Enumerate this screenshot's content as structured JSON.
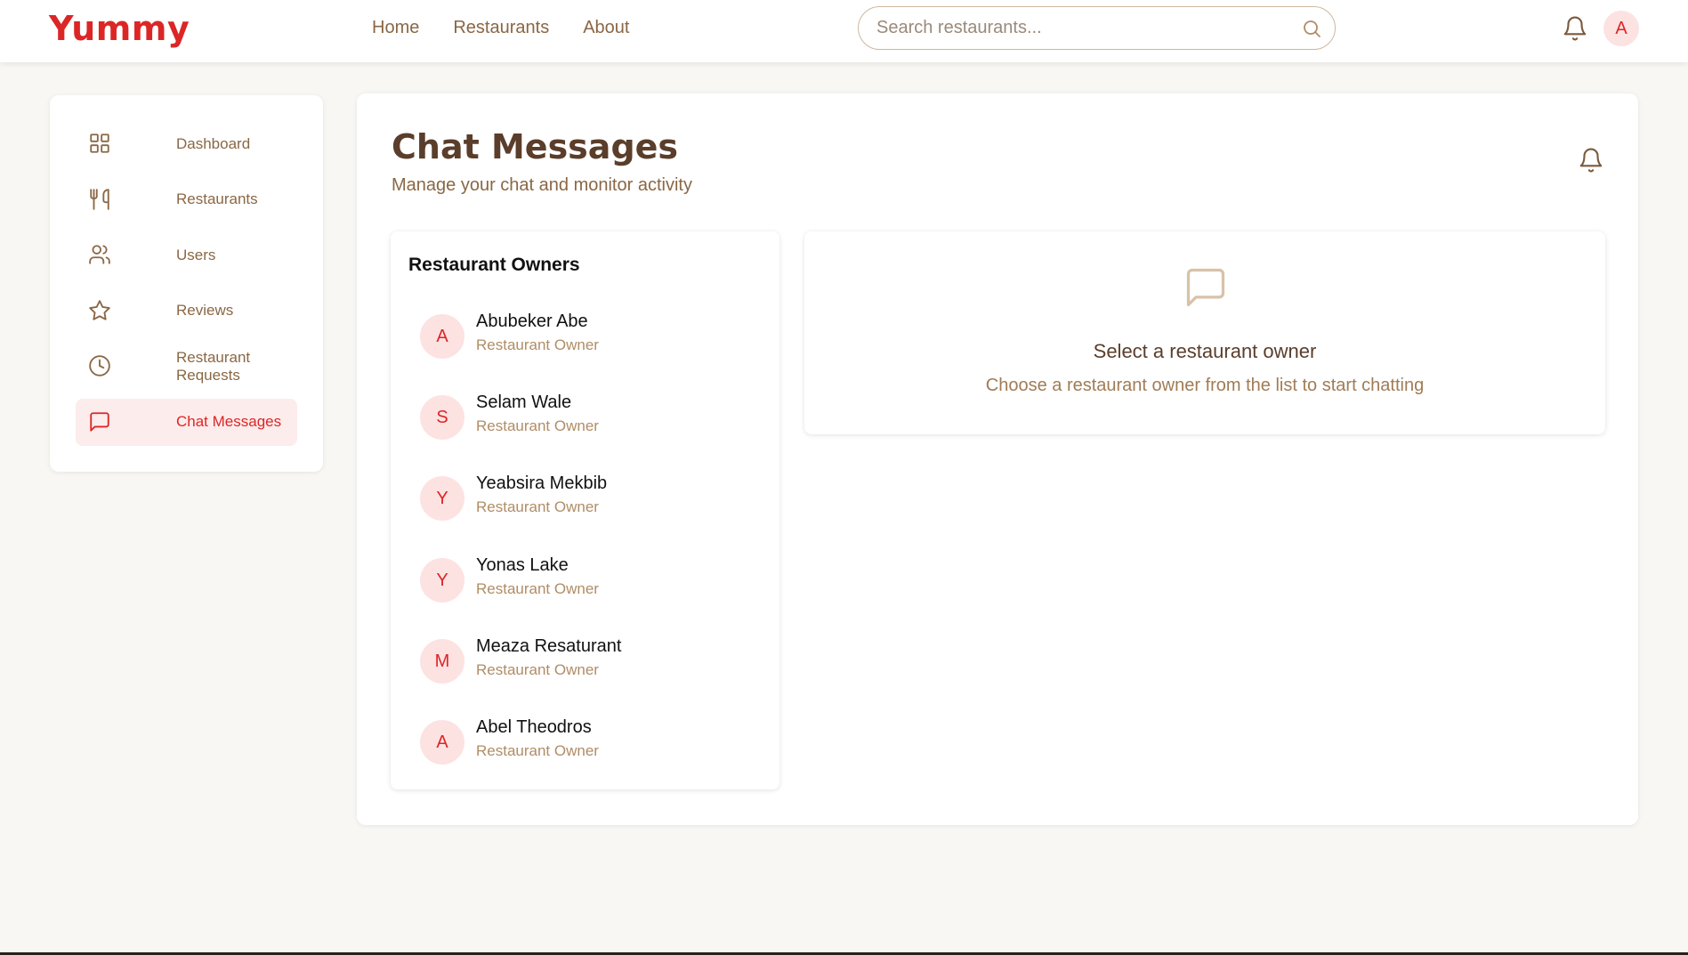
{
  "header": {
    "logo": "Yummy",
    "nav": [
      "Home",
      "Restaurants",
      "About"
    ],
    "search_placeholder": "Search restaurants...",
    "avatar_initial": "A"
  },
  "sidebar": {
    "items": [
      {
        "label": "Dashboard",
        "icon": "grid-icon",
        "active": false
      },
      {
        "label": "Restaurants",
        "icon": "utensils-icon",
        "active": false
      },
      {
        "label": "Users",
        "icon": "users-icon",
        "active": false
      },
      {
        "label": "Reviews",
        "icon": "star-icon",
        "active": false
      },
      {
        "label": "Restaurant Requests",
        "icon": "clock-icon",
        "active": false
      },
      {
        "label": "Chat Messages",
        "icon": "message-icon",
        "active": true
      }
    ]
  },
  "main": {
    "title": "Chat Messages",
    "subtitle": "Manage your chat and monitor activity",
    "owners_title": "Restaurant Owners",
    "owners": [
      {
        "initial": "A",
        "name": "Abubeker Abe",
        "role": "Restaurant Owner"
      },
      {
        "initial": "S",
        "name": "Selam Wale",
        "role": "Restaurant Owner"
      },
      {
        "initial": "Y",
        "name": "Yeabsira Mekbib",
        "role": "Restaurant Owner"
      },
      {
        "initial": "Y",
        "name": "Yonas Lake",
        "role": "Restaurant Owner"
      },
      {
        "initial": "M",
        "name": "Meaza Resaturant",
        "role": "Restaurant Owner"
      },
      {
        "initial": "A",
        "name": "Abel Theodros",
        "role": "Restaurant Owner"
      }
    ],
    "empty_title": "Select a restaurant owner",
    "empty_subtitle": "Choose a restaurant owner from the list to start chatting"
  },
  "colors": {
    "brand": "#dc2626",
    "text_brown": "#5a3e2b",
    "muted_brown": "#8a6744",
    "avatar_bg": "#fde2e2",
    "page_bg": "#f8f7f3"
  }
}
